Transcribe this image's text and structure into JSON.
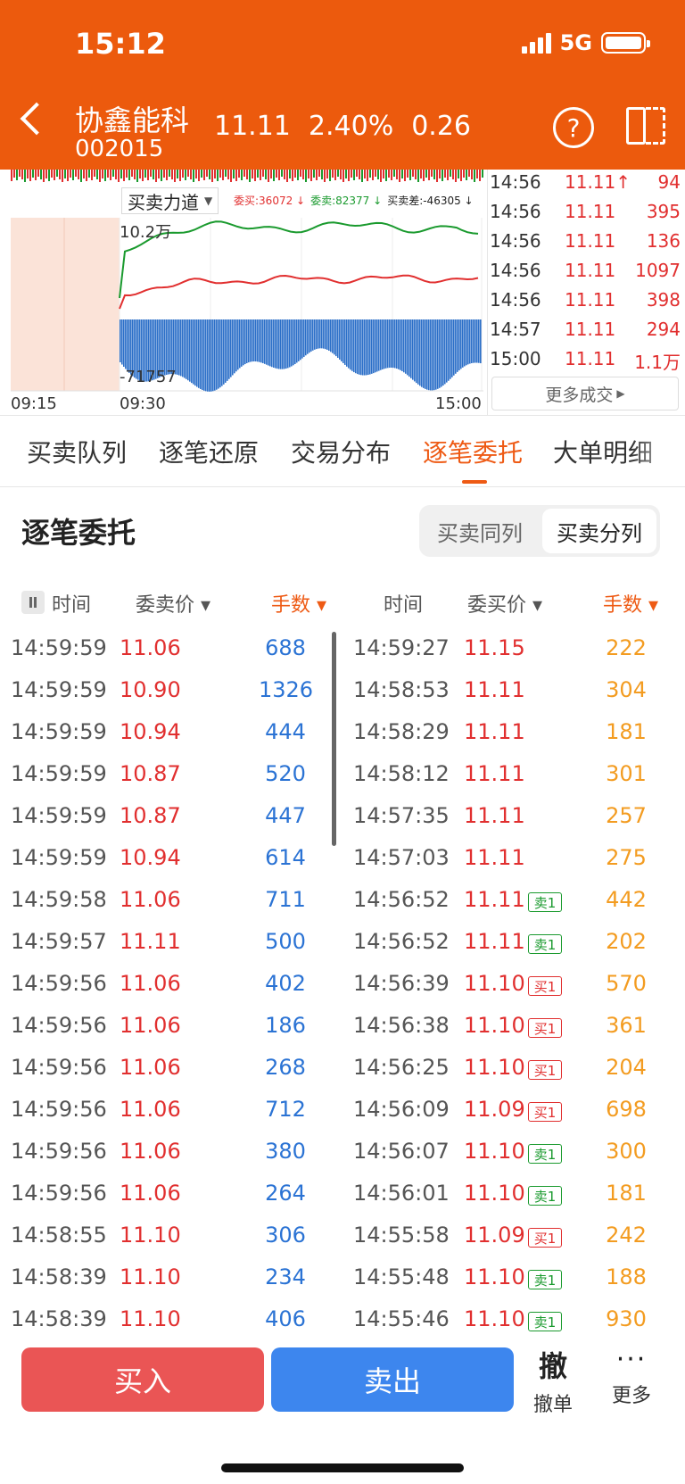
{
  "status_bar": {
    "time": "15:12",
    "network": "5G"
  },
  "header": {
    "stock_name": "协鑫能科",
    "stock_code": "002015",
    "price": "11.11",
    "change_pct": "2.40%",
    "change": "0.26"
  },
  "chart": {
    "selector_label": "买卖力道",
    "legend": {
      "buy": "委买:36072 ↓",
      "sell": "委卖:82377 ↓",
      "diff": "买卖差:-46305 ↓"
    },
    "y_top_label": "10.2万",
    "y_bottom_label": "-71757",
    "x_labels": [
      "09:15",
      "09:30",
      "15:00"
    ]
  },
  "trades": {
    "rows": [
      {
        "time": "14:56",
        "price": "11.11↑",
        "vol": "94"
      },
      {
        "time": "14:56",
        "price": "11.11",
        "vol": "395"
      },
      {
        "time": "14:56",
        "price": "11.11",
        "vol": "136"
      },
      {
        "time": "14:56",
        "price": "11.11",
        "vol": "1097"
      },
      {
        "time": "14:56",
        "price": "11.11",
        "vol": "398"
      },
      {
        "time": "14:57",
        "price": "11.11",
        "vol": "294"
      },
      {
        "time": "15:00",
        "price": "11.11",
        "vol": "1.1万"
      }
    ],
    "more_label": "更多成交"
  },
  "tabs": [
    "买卖队列",
    "逐笔还原",
    "交易分布",
    "逐笔委托",
    "大单明细"
  ],
  "active_tab": 3,
  "section": {
    "title": "逐笔委托",
    "seg_same": "买卖同列",
    "seg_split": "买卖分列"
  },
  "columns": {
    "left_time": "时间",
    "left_price": "委卖价",
    "left_vol": "手数",
    "right_time": "时间",
    "right_price": "委买价",
    "right_vol": "手数"
  },
  "orders": [
    {
      "lt": "14:59:59",
      "lp": "11.06",
      "lv": "688",
      "rt": "14:59:27",
      "rp": "11.15",
      "badge": "",
      "rv": "222"
    },
    {
      "lt": "14:59:59",
      "lp": "10.90",
      "lv": "1326",
      "rt": "14:58:53",
      "rp": "11.11",
      "badge": "",
      "rv": "304"
    },
    {
      "lt": "14:59:59",
      "lp": "10.94",
      "lv": "444",
      "rt": "14:58:29",
      "rp": "11.11",
      "badge": "",
      "rv": "181"
    },
    {
      "lt": "14:59:59",
      "lp": "10.87",
      "lv": "520",
      "rt": "14:58:12",
      "rp": "11.11",
      "badge": "",
      "rv": "301"
    },
    {
      "lt": "14:59:59",
      "lp": "10.87",
      "lv": "447",
      "rt": "14:57:35",
      "rp": "11.11",
      "badge": "",
      "rv": "257"
    },
    {
      "lt": "14:59:59",
      "lp": "10.94",
      "lv": "614",
      "rt": "14:57:03",
      "rp": "11.11",
      "badge": "",
      "rv": "275"
    },
    {
      "lt": "14:59:58",
      "lp": "11.06",
      "lv": "711",
      "rt": "14:56:52",
      "rp": "11.11",
      "badge": "卖1",
      "rv": "442"
    },
    {
      "lt": "14:59:57",
      "lp": "11.11",
      "lv": "500",
      "rt": "14:56:52",
      "rp": "11.11",
      "badge": "卖1",
      "rv": "202"
    },
    {
      "lt": "14:59:56",
      "lp": "11.06",
      "lv": "402",
      "rt": "14:56:39",
      "rp": "11.10",
      "badge": "买1",
      "rv": "570"
    },
    {
      "lt": "14:59:56",
      "lp": "11.06",
      "lv": "186",
      "rt": "14:56:38",
      "rp": "11.10",
      "badge": "买1",
      "rv": "361"
    },
    {
      "lt": "14:59:56",
      "lp": "11.06",
      "lv": "268",
      "rt": "14:56:25",
      "rp": "11.10",
      "badge": "买1",
      "rv": "204"
    },
    {
      "lt": "14:59:56",
      "lp": "11.06",
      "lv": "712",
      "rt": "14:56:09",
      "rp": "11.09",
      "badge": "买1",
      "rv": "698"
    },
    {
      "lt": "14:59:56",
      "lp": "11.06",
      "lv": "380",
      "rt": "14:56:07",
      "rp": "11.10",
      "badge": "卖1",
      "rv": "300"
    },
    {
      "lt": "14:59:56",
      "lp": "11.06",
      "lv": "264",
      "rt": "14:56:01",
      "rp": "11.10",
      "badge": "卖1",
      "rv": "181"
    },
    {
      "lt": "14:58:55",
      "lp": "11.10",
      "lv": "306",
      "rt": "14:55:58",
      "rp": "11.09",
      "badge": "买1",
      "rv": "242"
    },
    {
      "lt": "14:58:39",
      "lp": "11.10",
      "lv": "234",
      "rt": "14:55:48",
      "rp": "11.10",
      "badge": "卖1",
      "rv": "188"
    },
    {
      "lt": "14:58:39",
      "lp": "11.10",
      "lv": "406",
      "rt": "14:55:46",
      "rp": "11.10",
      "badge": "卖1",
      "rv": "930"
    }
  ],
  "bottom": {
    "buy": "买入",
    "sell": "卖出",
    "cancel_icon_text": "撤",
    "cancel_label": "撤单",
    "more_label": "更多"
  },
  "colors": {
    "header_bg": "#ec5a0d",
    "price_red": "#e12f2f",
    "sell_vol_blue": "#2b73d4",
    "buy_vol_orange": "#f39c21",
    "buy_green_line": "#1a9a2e",
    "active_tab": "#ee5a14"
  }
}
